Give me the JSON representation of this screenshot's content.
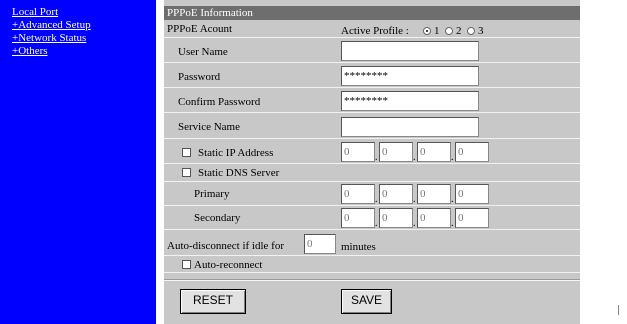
{
  "sidebar": {
    "items": [
      "Local Port",
      "+Advanced Setup",
      "+Network Status",
      "+Others"
    ]
  },
  "section_title": "PPPoE Information",
  "account": {
    "label": "PPPoE Acount",
    "profile_label": "Active Profile :",
    "profiles": [
      "1",
      "2",
      "3"
    ],
    "selected_profile": "1"
  },
  "fields": {
    "username_label": "User Name",
    "username_value": "",
    "password_label": "Password",
    "password_value": "********",
    "confirm_label": "Confirm Password",
    "confirm_value": "********",
    "service_label": "Service Name",
    "service_value": ""
  },
  "static_ip": {
    "label": "Static IP Address",
    "checked": false,
    "octets": [
      "0",
      "0",
      "0",
      "0"
    ]
  },
  "static_dns": {
    "label": "Static DNS Server",
    "checked": false,
    "primary_label": "Primary",
    "primary": [
      "0",
      "0",
      "0",
      "0"
    ],
    "secondary_label": "Secondary",
    "secondary": [
      "0",
      "0",
      "0",
      "0"
    ]
  },
  "idle": {
    "label": "Auto-disconnect if idle for",
    "value": "0",
    "unit": "minutes"
  },
  "reconnect": {
    "label": "Auto-reconnect",
    "checked": false
  },
  "buttons": {
    "reset": "RESET",
    "save": "SAVE"
  },
  "colors": {
    "sidebar": "#0000ff",
    "panel": "#c8c8c8",
    "header": "#6e6e6e"
  }
}
